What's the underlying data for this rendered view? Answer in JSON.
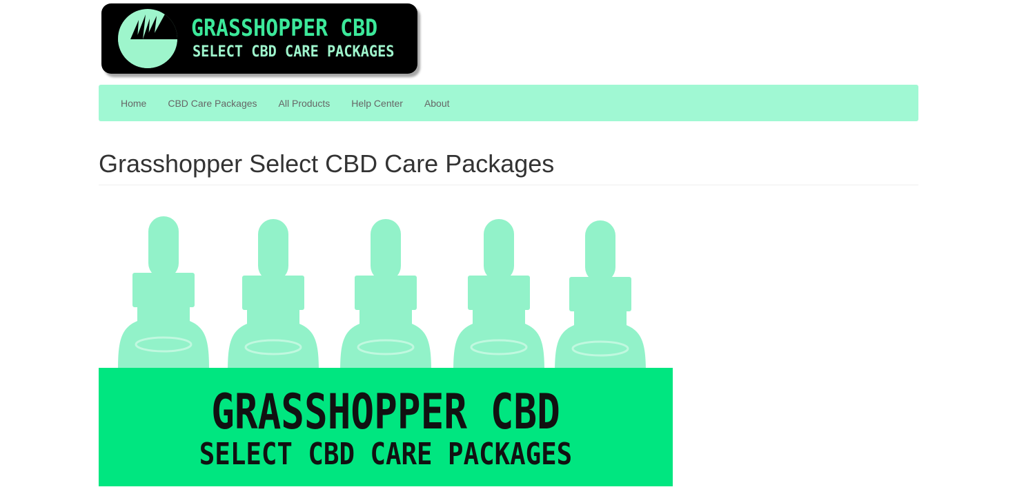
{
  "logo": {
    "title": "GRASSHOPPER CBD",
    "subtitle": "SELECT CBD CARE PACKAGES",
    "colors": {
      "background": "#000000",
      "title": "#3ce89a",
      "subtitle": "#9ef5cc",
      "circle": "#9ef5cc"
    }
  },
  "nav": {
    "items": [
      {
        "label": "Home"
      },
      {
        "label": "CBD Care Packages"
      },
      {
        "label": "All Products"
      },
      {
        "label": "Help Center"
      },
      {
        "label": "About"
      }
    ],
    "background": "#a0f8d3"
  },
  "page": {
    "title": "Grasshopper Select CBD Care Packages"
  },
  "hero": {
    "banner_title": "GRASSHOPPER CBD",
    "banner_subtitle": "SELECT CBD CARE PACKAGES",
    "banner_color": "#00e680",
    "bottle_color": "#7ff0c0",
    "bottle_count": 5
  }
}
